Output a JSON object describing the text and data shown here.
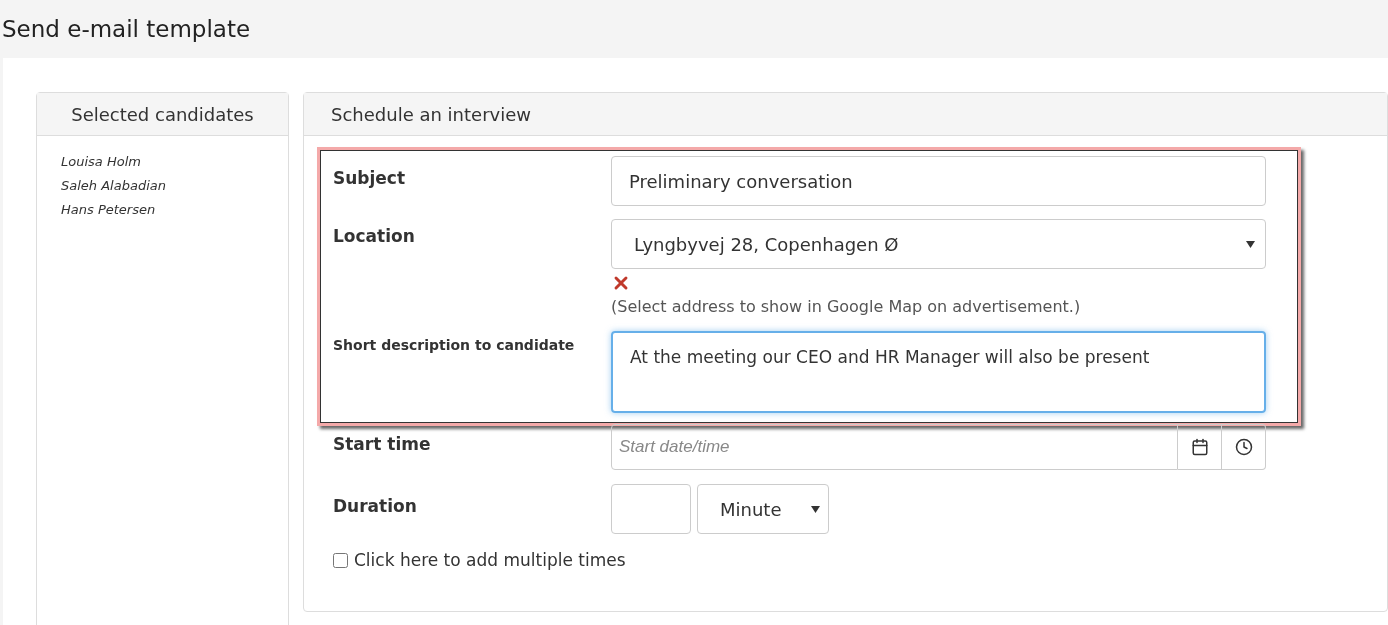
{
  "page": {
    "title": "Send e-mail template"
  },
  "candidates": {
    "title": "Selected candidates",
    "names": [
      "Louisa Holm",
      "Saleh Alabadian",
      "Hans Petersen"
    ]
  },
  "interview": {
    "title": "Schedule an interview",
    "subject": {
      "label": "Subject",
      "value": "Preliminary conversation"
    },
    "location": {
      "label": "Location",
      "value": "Lyngbyvej 28, Copenhagen Ø",
      "hint": "(Select address to show in Google Map on advertisement.)"
    },
    "description": {
      "label": "Short description to candidate",
      "value": "At the meeting our CEO and HR Manager will also be present",
      "focused": true
    },
    "start_time": {
      "label": "Start time",
      "placeholder": "Start date/time"
    },
    "duration": {
      "label": "Duration",
      "unit": "Minute"
    },
    "multiple_times": {
      "label": "Click here to add multiple times",
      "checked": false
    }
  }
}
